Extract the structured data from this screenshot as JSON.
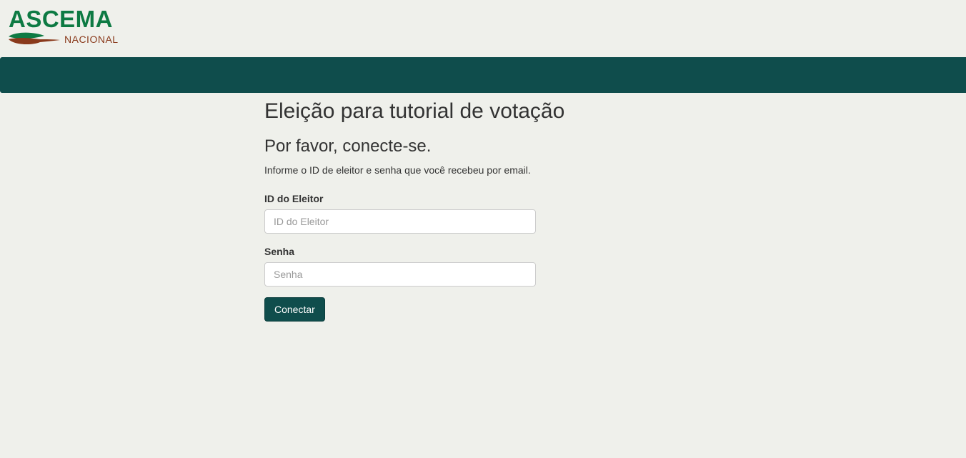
{
  "brand": {
    "name": "ASCEMA",
    "subtitle": "NACIONAL",
    "primary_color": "#0d7a43",
    "secondary_color": "#8a3a1c",
    "logo_icon": "leaf-icon"
  },
  "navbar": {
    "color": "#0f4d4c"
  },
  "page": {
    "election_title": "Eleição para tutorial de votação",
    "login_heading": "Por favor, conecte-se.",
    "instructions": "Informe o ID de eleitor e senha que você recebeu por email."
  },
  "form": {
    "voter_id": {
      "label": "ID do Eleitor",
      "placeholder": "ID do Eleitor",
      "value": ""
    },
    "password": {
      "label": "Senha",
      "placeholder": "Senha",
      "value": ""
    },
    "submit_label": "Conectar",
    "submit_color": "#0f4d4c"
  }
}
